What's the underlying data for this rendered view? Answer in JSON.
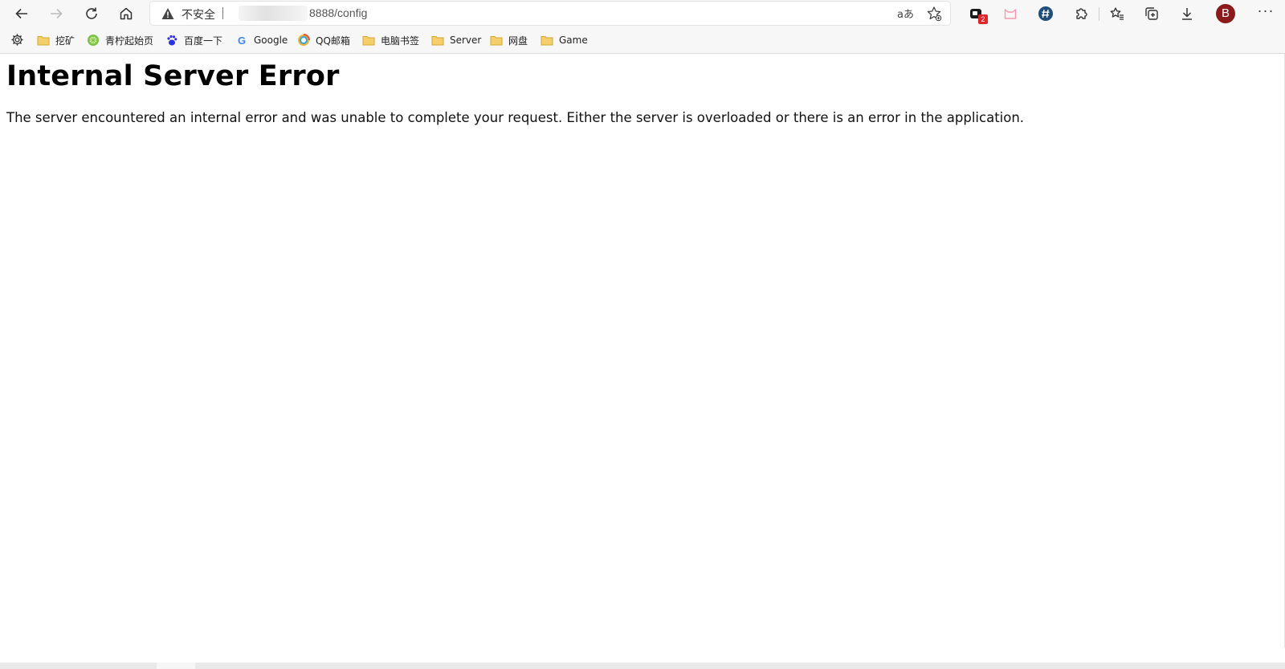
{
  "browser": {
    "security_label": "不安全",
    "url_visible": "8888/config",
    "translate_glyph": "aあ",
    "extension_badge": "2",
    "profile_initial": "B",
    "more_glyph": "···"
  },
  "bookmarks": [
    {
      "label": "挖矿",
      "icon": "folder-icon"
    },
    {
      "label": "青柠起始页",
      "icon": "lime-icon"
    },
    {
      "label": "百度一下",
      "icon": "baidu-paw-icon"
    },
    {
      "label": "Google",
      "icon": "google-icon"
    },
    {
      "label": "QQ邮箱",
      "icon": "qq-mail-icon"
    },
    {
      "label": "电脑书签",
      "icon": "folder-icon"
    },
    {
      "label": "Server",
      "icon": "folder-icon"
    },
    {
      "label": "网盘",
      "icon": "folder-icon"
    },
    {
      "label": "Game",
      "icon": "folder-icon"
    }
  ],
  "page": {
    "title": "Internal Server Error",
    "message": "The server encountered an internal error and was unable to complete your request. Either the server is overloaded or there is an error in the application."
  },
  "colors": {
    "toolbar_bg": "#f7f7f7",
    "avatar": "#8b1a1a",
    "badge": "#e0262b",
    "folder": "#f5cf6b"
  }
}
